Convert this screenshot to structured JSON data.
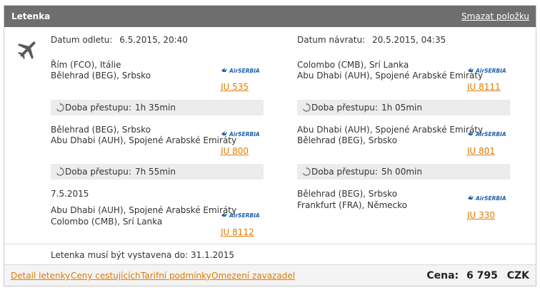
{
  "header": {
    "title": "Letenka",
    "remove_label": "Smazat položku"
  },
  "outbound": {
    "departure_label": "Datum odletu:",
    "departure_value": "6.5.2015, 20:40",
    "seg1": {
      "from": "Řím (FCO), Itálie",
      "to": "Bělehrad (BEG), Srbsko",
      "flight": "JU 535"
    },
    "transfer1": {
      "label": "Doba přestupu:",
      "value": "1h 35min"
    },
    "seg2": {
      "from": "Bělehrad (BEG), Srbsko",
      "to": "Abu Dhabi (AUH), Spojené Arabské Emiráty",
      "flight": "JU 800"
    },
    "transfer2": {
      "label": "Doba přestupu:",
      "value": "7h 55min"
    },
    "date2": "7.5.2015",
    "seg3": {
      "from": "Abu Dhabi (AUH), Spojené Arabské Emiráty",
      "to": "Colombo (CMB), Srí Lanka",
      "flight": "JU 8112"
    }
  },
  "return": {
    "return_label": "Datum návratu:",
    "return_value": "20.5.2015, 04:35",
    "seg1": {
      "from": "Colombo (CMB), Srí Lanka",
      "to": "Abu Dhabi (AUH), Spojené Arabské Emiráty",
      "flight": "JU 8111"
    },
    "transfer1": {
      "label": "Doba přestupu:",
      "value": "1h 05min"
    },
    "seg2": {
      "from": "Abu Dhabi (AUH), Spojené Arabské Emiráty",
      "to": "Bělehrad (BEG), Srbsko",
      "flight": "JU 801"
    },
    "transfer2": {
      "label": "Doba přestupu:",
      "value": "5h 00min"
    },
    "seg3": {
      "from": "Bělehrad (BEG), Srbsko",
      "to": "Frankfurt (FRA), Německo",
      "flight": "JU 330"
    }
  },
  "airline_logo_text": "AirSERBIA",
  "ticket_note": "Letenka musí být vystavena do: 31.1.2015",
  "footer": {
    "links": [
      "Detail letenky",
      "Ceny cestujících",
      "Tarifní podmínky",
      "Omezení zavazadel"
    ],
    "price_label": "Cena:",
    "price_value": "6 795",
    "currency": "CZK"
  },
  "colors": {
    "header_bg": "#6e6e6e",
    "link": "#e07b00",
    "airline_blue": "#1f5fa8"
  }
}
